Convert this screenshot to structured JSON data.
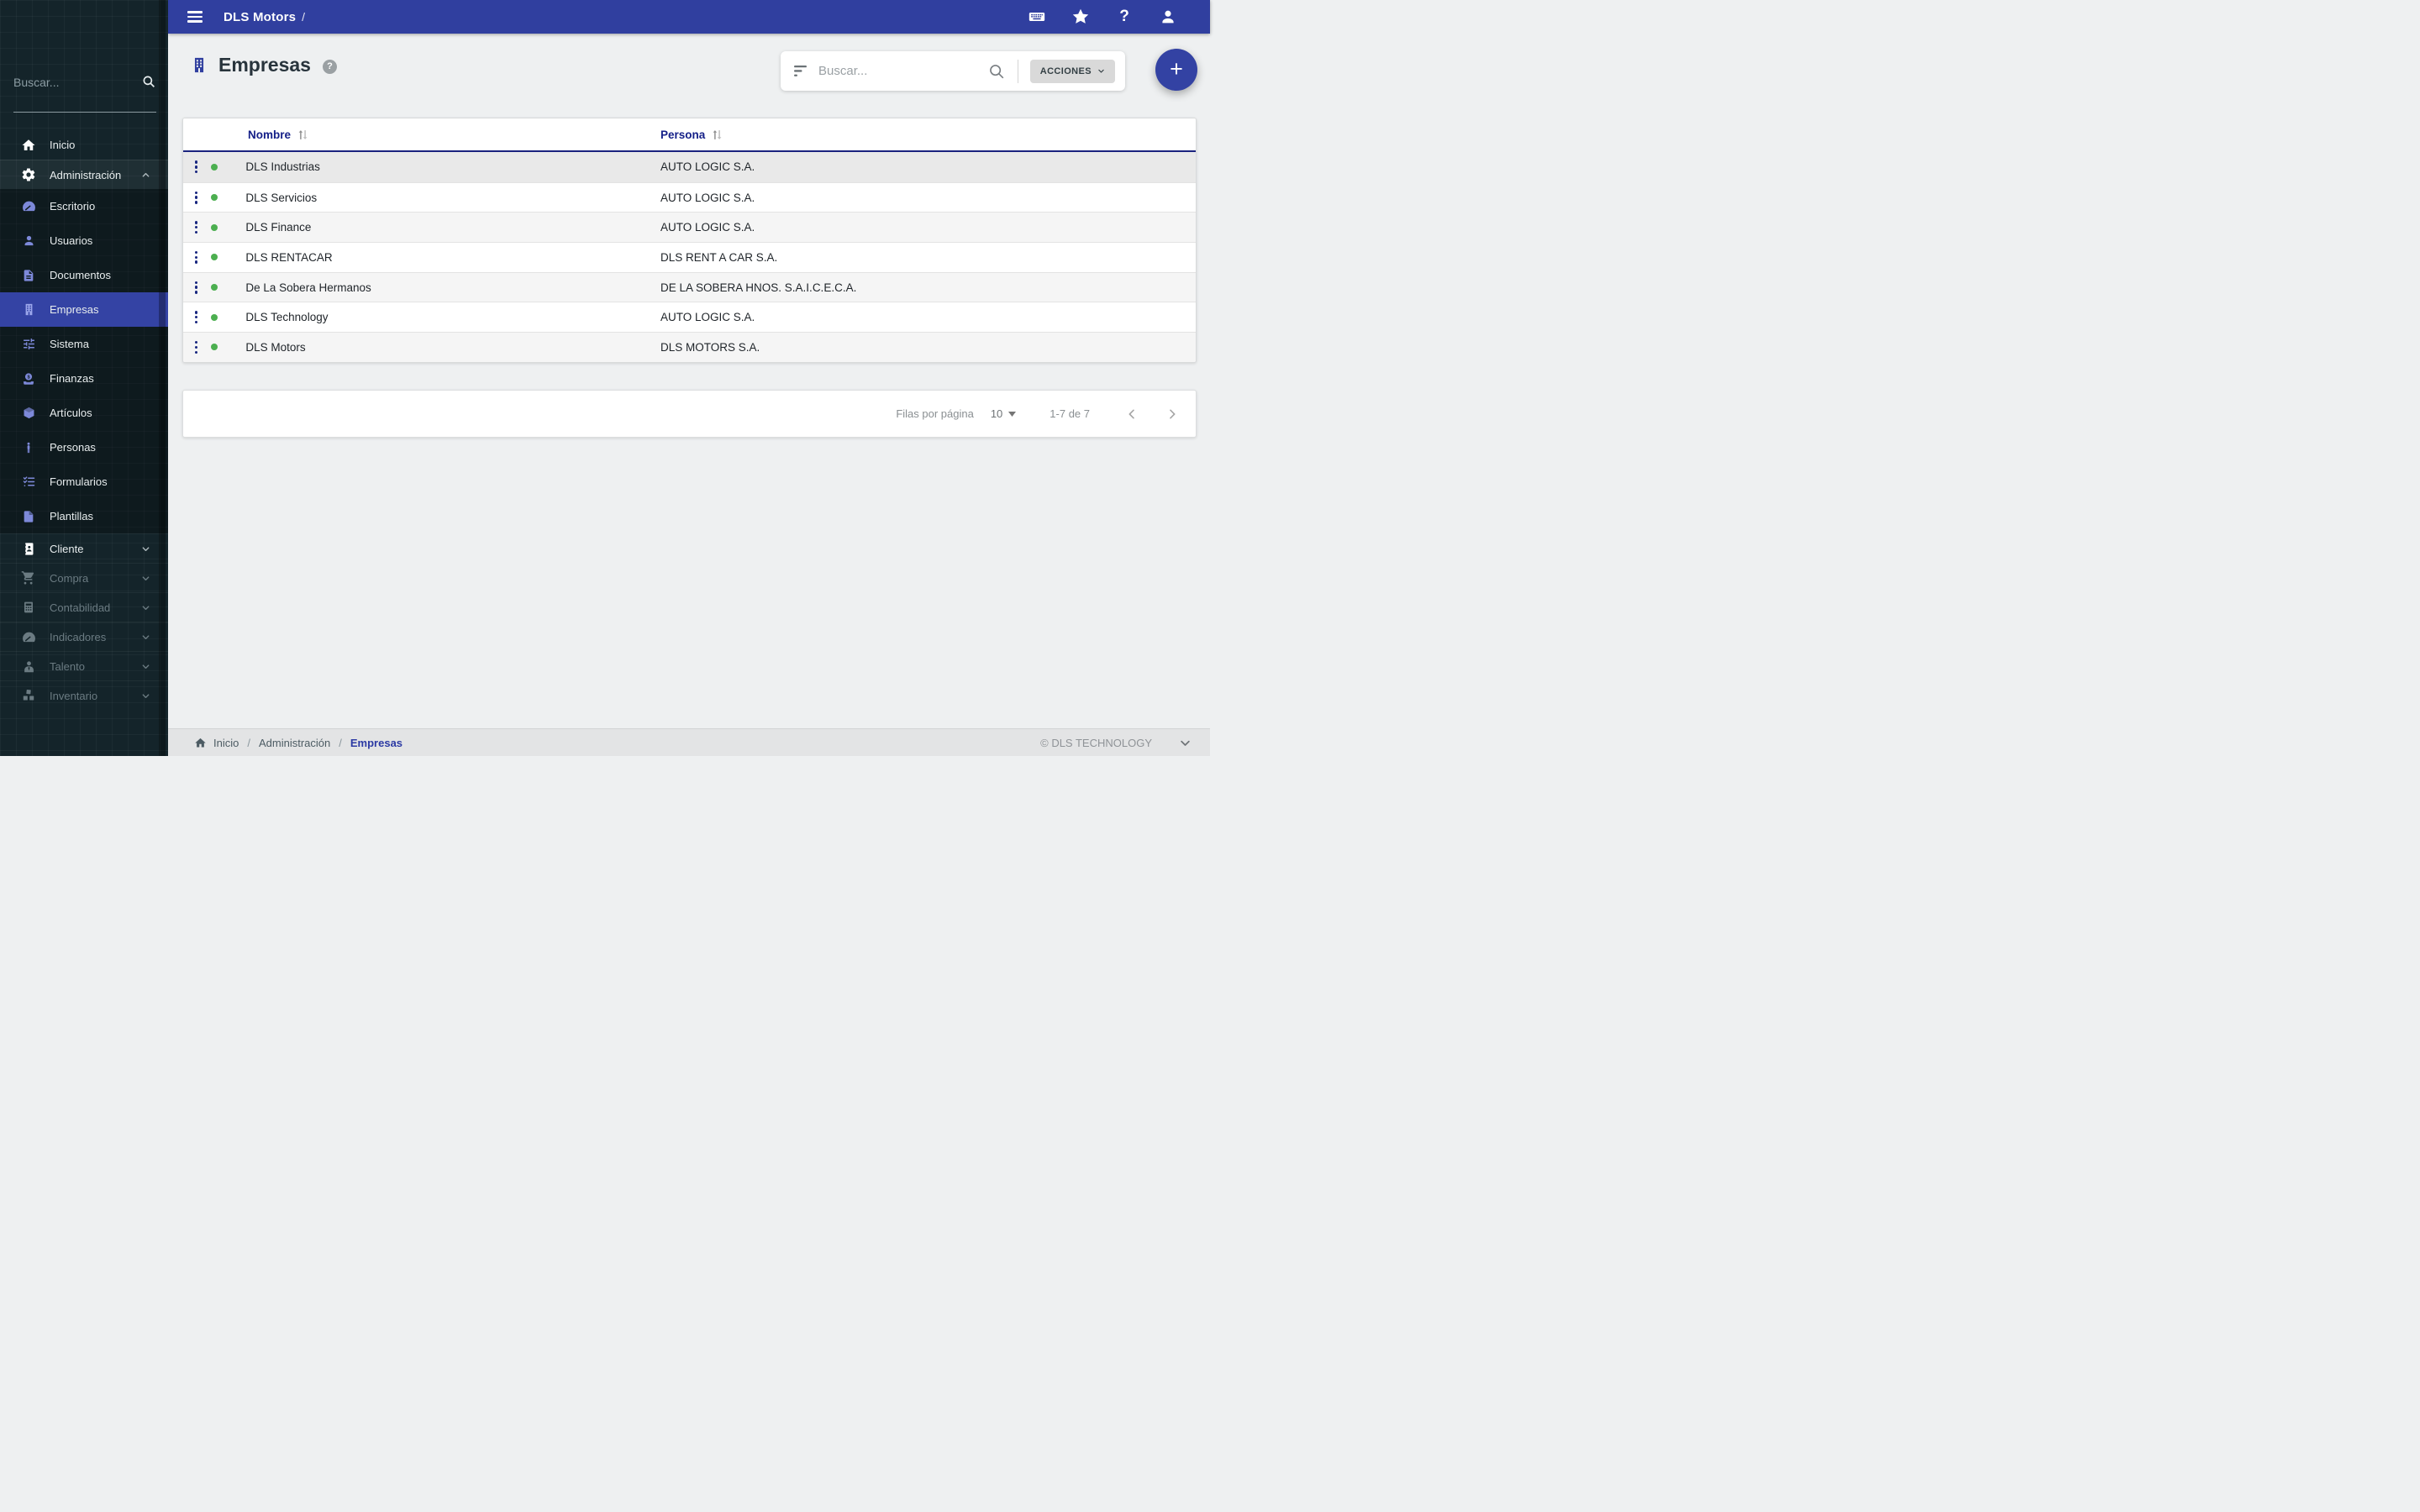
{
  "topbar": {
    "title": "DLS Motors",
    "suffix": "/",
    "icons": [
      {
        "name": "keyboard-icon"
      },
      {
        "name": "star-icon"
      },
      {
        "name": "help-icon"
      },
      {
        "name": "account-icon"
      }
    ]
  },
  "glyphs": {
    "question": "?",
    "plus": "+"
  },
  "sidebar": {
    "search_placeholder": "Buscar...",
    "items_top": [
      {
        "label": "Inicio",
        "icon": "home-icon"
      },
      {
        "label": "Administración",
        "icon": "gears-icon",
        "expanded": true
      }
    ],
    "admin_submenu": [
      {
        "label": "Escritorio",
        "icon": "gauge-icon"
      },
      {
        "label": "Usuarios",
        "icon": "user-icon"
      },
      {
        "label": "Documentos",
        "icon": "document-icon"
      },
      {
        "label": "Empresas",
        "icon": "building-icon",
        "active": true
      },
      {
        "label": "Sistema",
        "icon": "sliders-icon"
      },
      {
        "label": "Finanzas",
        "icon": "savings-icon"
      },
      {
        "label": "Artículos",
        "icon": "box-icon"
      },
      {
        "label": "Personas",
        "icon": "person-icon"
      },
      {
        "label": "Formularios",
        "icon": "checklist-icon"
      },
      {
        "label": "Plantillas",
        "icon": "file-icon"
      }
    ],
    "items_bottom": [
      {
        "label": "Cliente",
        "icon": "contacts-icon",
        "bright": true
      },
      {
        "label": "Compra",
        "icon": "cart-icon"
      },
      {
        "label": "Contabilidad",
        "icon": "calculator-icon"
      },
      {
        "label": "Indicadores",
        "icon": "gauge-icon"
      },
      {
        "label": "Talento",
        "icon": "talent-icon"
      },
      {
        "label": "Inventario",
        "icon": "inventory-icon"
      }
    ]
  },
  "header": {
    "title": "Empresas"
  },
  "toolbar": {
    "search_placeholder": "Buscar...",
    "actions_label": "ACCIONES"
  },
  "table": {
    "columns": [
      {
        "label": "Nombre"
      },
      {
        "label": "Persona"
      }
    ],
    "rows": [
      {
        "name": "DLS Industrias",
        "persona": "AUTO LOGIC S.A.",
        "status": "green"
      },
      {
        "name": "DLS Servicios",
        "persona": "AUTO LOGIC S.A.",
        "status": "green"
      },
      {
        "name": "DLS Finance",
        "persona": "AUTO LOGIC S.A.",
        "status": "green"
      },
      {
        "name": "DLS RENTACAR",
        "persona": "DLS RENT A CAR S.A.",
        "status": "green"
      },
      {
        "name": "De La Sobera Hermanos",
        "persona": "DE LA SOBERA HNOS. S.A.I.C.E.C.A.",
        "status": "green"
      },
      {
        "name": "DLS Technology",
        "persona": "AUTO LOGIC S.A.",
        "status": "green"
      },
      {
        "name": "DLS Motors",
        "persona": "DLS MOTORS S.A.",
        "status": "green"
      }
    ]
  },
  "pagination": {
    "rows_per_page_label": "Filas por página",
    "rows_per_page_value": "10",
    "range": "1-7 de 7"
  },
  "footer": {
    "breadcrumb": [
      {
        "label": "Inicio"
      },
      {
        "label": "Administración"
      },
      {
        "label": "Empresas",
        "current": true
      }
    ],
    "separator": "/",
    "copyright": "© DLS TECHNOLOGY"
  },
  "colors": {
    "topbar": "#303f9f",
    "sidebar_bg": "#14242a",
    "active_item": "#3443a4",
    "submenu_icon": "#7d89d9",
    "status_green": "#4caf50",
    "table_header_text": "#1a237e"
  }
}
